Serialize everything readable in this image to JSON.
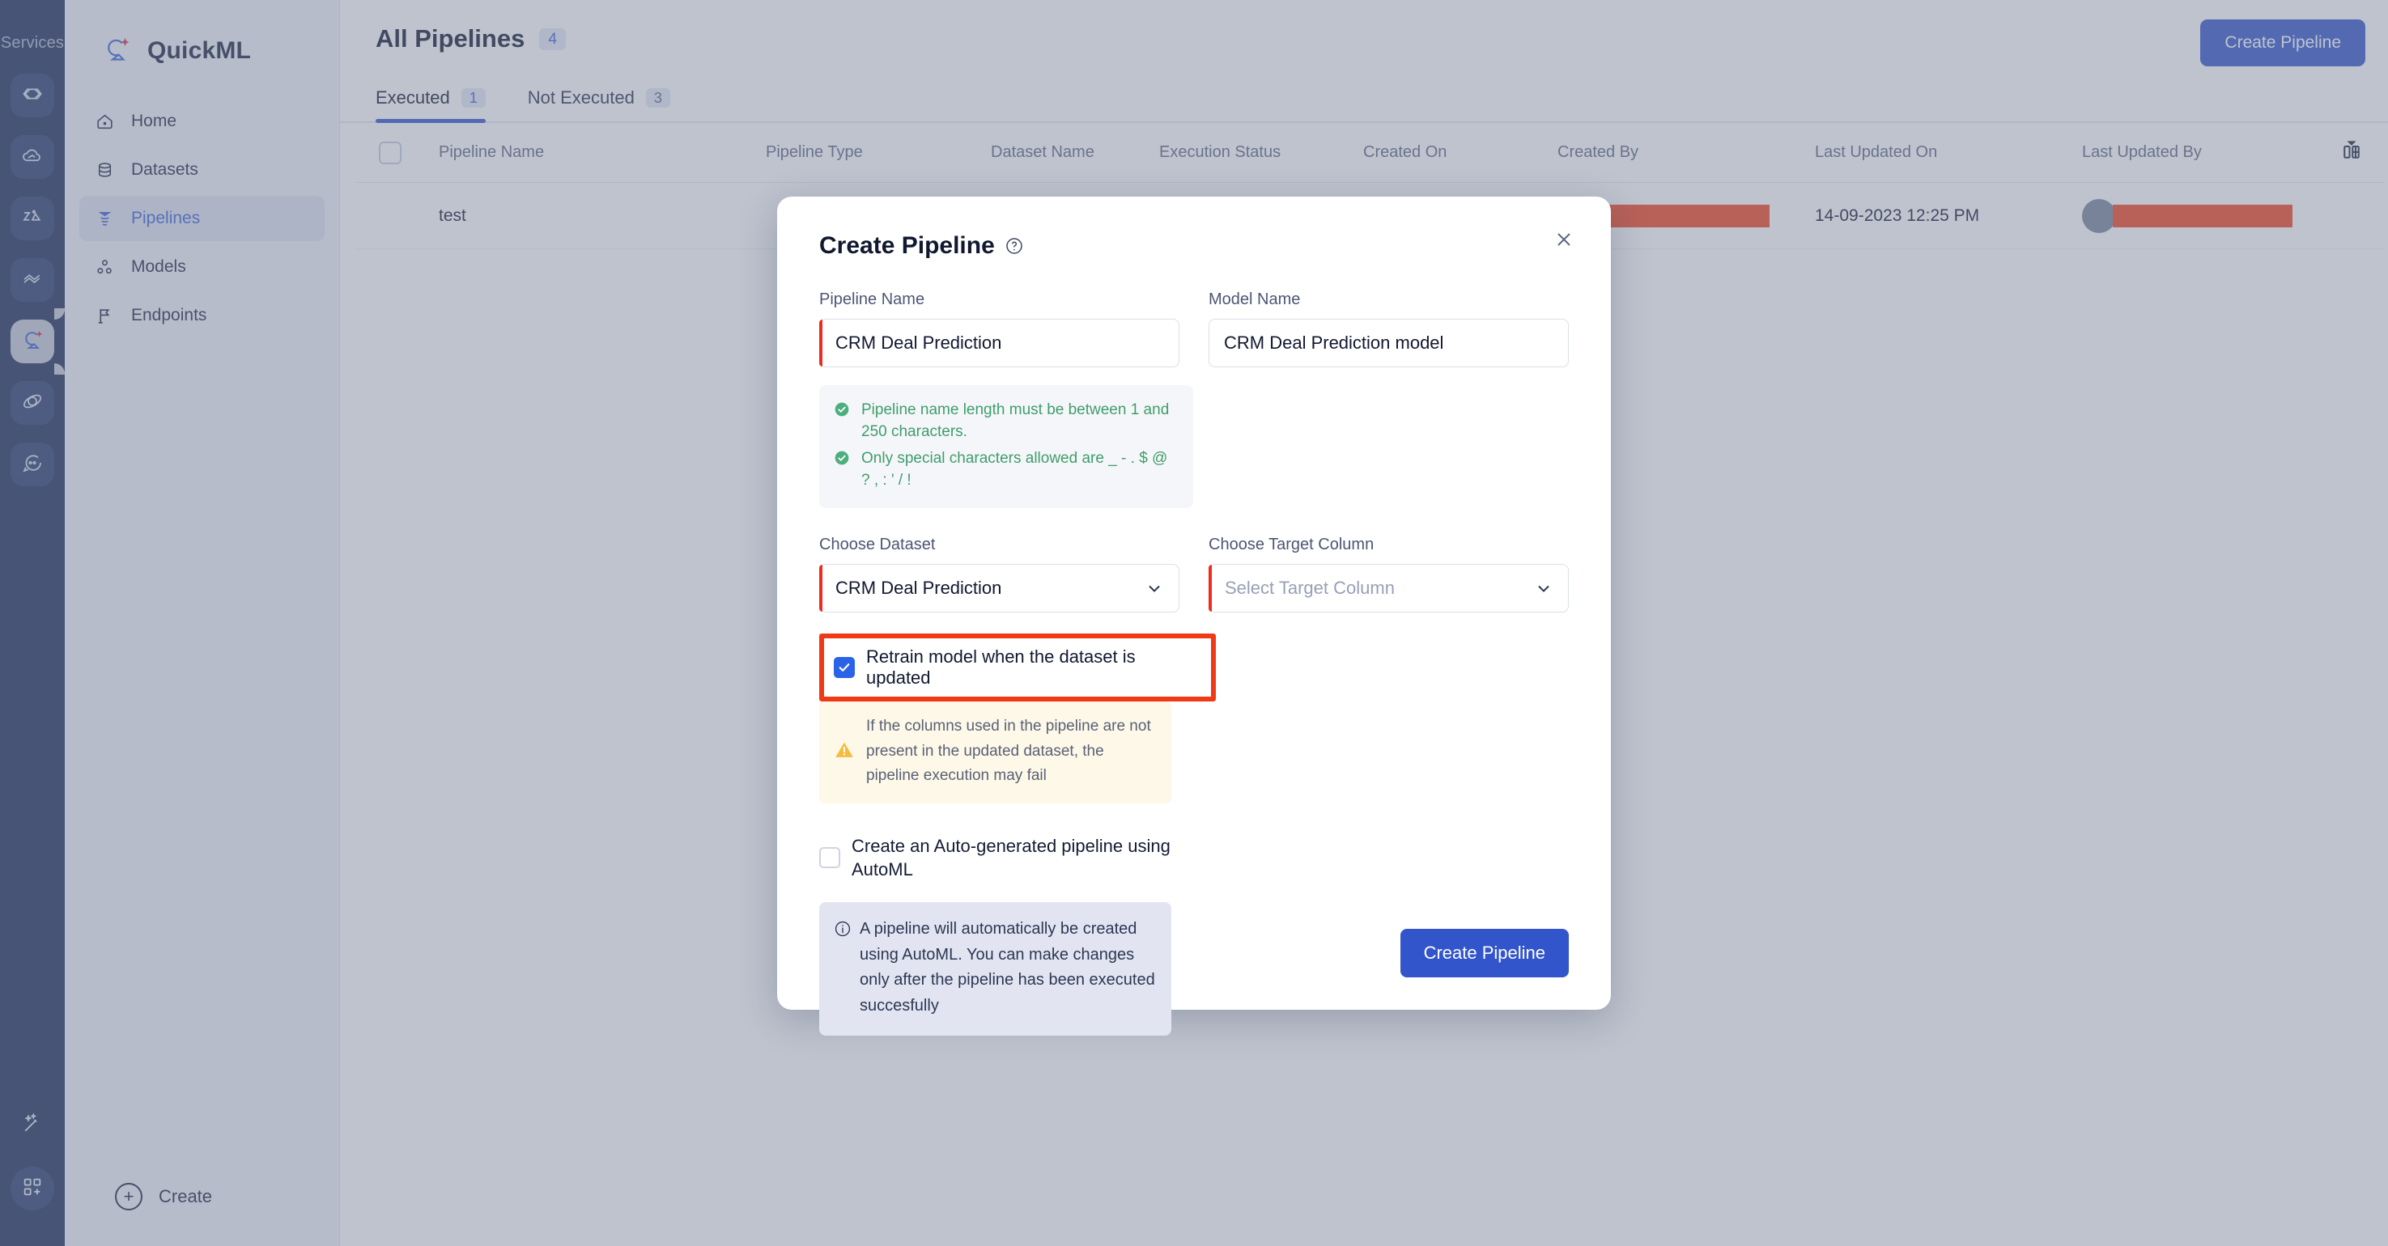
{
  "rail": {
    "title": "Services",
    "items": [
      {
        "icon": "code-brackets-icon",
        "name": "service-code"
      },
      {
        "icon": "cloud-deploy-icon",
        "name": "service-cloud"
      },
      {
        "icon": "analytics-icon",
        "name": "service-analytics"
      },
      {
        "icon": "flow-icon",
        "name": "service-flow"
      },
      {
        "icon": "quickml-logo-icon",
        "name": "service-quickml",
        "active": true
      },
      {
        "icon": "orbit-icon",
        "name": "service-orbit"
      },
      {
        "icon": "chat-icon",
        "name": "service-chat"
      }
    ],
    "bottom": [
      {
        "icon": "magic-wand-icon",
        "name": "rail-magic"
      },
      {
        "icon": "apps-grid-plus-icon",
        "name": "rail-apps"
      }
    ]
  },
  "sidebar": {
    "brand": "QuickML",
    "brand_icon": "quickml-logo-icon",
    "items": [
      {
        "label": "Home",
        "icon": "home-icon",
        "active": false
      },
      {
        "label": "Datasets",
        "icon": "database-icon",
        "active": false
      },
      {
        "label": "Pipelines",
        "icon": "funnel-icon",
        "active": true
      },
      {
        "label": "Models",
        "icon": "models-nodes-icon",
        "active": false
      },
      {
        "label": "Endpoints",
        "icon": "flag-icon",
        "active": false
      }
    ],
    "create_label": "Create"
  },
  "header": {
    "title": "All Pipelines",
    "count": "4",
    "create_button": "Create Pipeline"
  },
  "tabs": [
    {
      "label": "Executed",
      "count": "1",
      "active": true
    },
    {
      "label": "Not Executed",
      "count": "3",
      "active": false
    }
  ],
  "table": {
    "columns": [
      "Pipeline Name",
      "Pipeline Type",
      "Dataset Name",
      "Execution Status",
      "Created On",
      "Created By",
      "Last Updated On",
      "Last Updated By"
    ],
    "tools_icon": "column-settings-icon",
    "rows": [
      {
        "pipeline_name": "test",
        "pipeline_type": "",
        "dataset_name": "",
        "execution_status": "",
        "created_on": "",
        "created_by": "[redacted]",
        "last_updated_on": "14-09-2023 12:25 PM",
        "last_updated_by": "[redacted]"
      }
    ]
  },
  "modal": {
    "title": "Create Pipeline",
    "help_icon": "help-circle-icon",
    "close_icon": "close-icon",
    "pipeline_name": {
      "label": "Pipeline Name",
      "value": "CRM Deal Prediction",
      "placeholder": "Pipeline Name",
      "required": true
    },
    "model_name": {
      "label": "Model Name",
      "value": "CRM Deal Prediction model",
      "placeholder": "Model Name",
      "required": false
    },
    "hints": [
      {
        "icon": "check-circle-icon",
        "text": "Pipeline name length must be between 1 and 250 characters."
      },
      {
        "icon": "check-circle-icon",
        "text": "Only special characters allowed are _ - . $ @ ? , : ' / !"
      }
    ],
    "choose_dataset": {
      "label": "Choose Dataset",
      "value": "CRM Deal Prediction",
      "required": true,
      "chevron": "chevron-down-icon"
    },
    "choose_target_column": {
      "label": "Choose Target Column",
      "value": "",
      "placeholder": "Select Target Column",
      "required": true,
      "chevron": "chevron-down-icon"
    },
    "retrain_checkbox": {
      "label": "Retrain model when the dataset is updated",
      "checked": true,
      "highlighted": true,
      "highlight_color": "#f03a16"
    },
    "retrain_warning": {
      "icon": "warning-triangle-icon",
      "text": "If the columns used in the pipeline are not present in the updated dataset, the pipeline execution may fail"
    },
    "automl_checkbox": {
      "label": "Create an Auto-generated pipeline using AutoML",
      "checked": false
    },
    "automl_info": {
      "icon": "info-circle-icon",
      "text": "A pipeline will automatically be created using AutoML. You can make changes only after the pipeline has been executed succesfully"
    },
    "submit_button": "Create Pipeline"
  },
  "colors": {
    "accent": "#3355cc",
    "rail_bg": "#1d2b57",
    "sidebar_bg": "#eff1f6",
    "success": "#3f9e6a",
    "highlight": "#f03a16",
    "redact": "#f4441e"
  }
}
